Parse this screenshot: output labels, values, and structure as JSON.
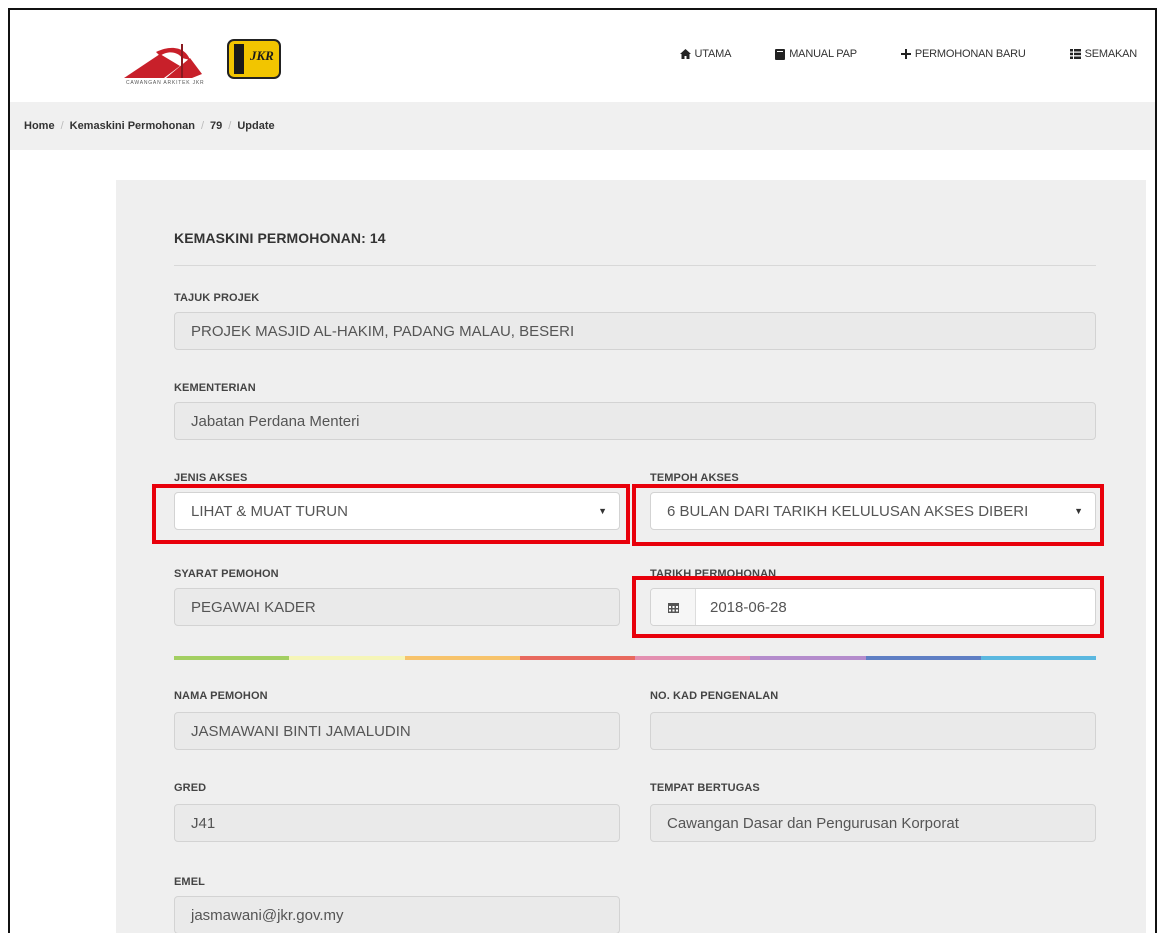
{
  "nav": {
    "utama": "UTAMA",
    "manual": "MANUAL PAP",
    "permohonan_baru": "PERMOHONAN BARU",
    "semakan": "SEMAKAN"
  },
  "logo": {
    "caption": "CAWANGAN ARKITEK JKR",
    "badge": "JKR"
  },
  "breadcrumb": [
    "Home",
    "Kemaskini Permohonan",
    "79",
    "Update"
  ],
  "form": {
    "title": "KEMASKINI PERMOHONAN: 14",
    "tajuk_label": "TAJUK PROJEK",
    "tajuk_value": "PROJEK MASJID AL-HAKIM, PADANG MALAU, BESERI",
    "kementerian_label": "KEMENTERIAN",
    "kementerian_value": "Jabatan Perdana Menteri",
    "jenis_label": "JENIS AKSES",
    "jenis_value": "LIHAT & MUAT TURUN",
    "tempoh_label": "TEMPOH AKSES",
    "tempoh_value": "6 BULAN DARI TARIKH KELULUSAN AKSES DIBERI",
    "syarat_label": "SYARAT PEMOHON",
    "syarat_value": "PEGAWAI KADER",
    "tarikh_label": "TARIKH PERMOHONAN",
    "tarikh_value": "2018-06-28",
    "nama_label": "NAMA PEMOHON",
    "nama_value": "JASMAWANI BINTI JAMALUDIN",
    "ic_label": "NO. KAD PENGENALAN",
    "ic_value": "",
    "gred_label": "GRED",
    "gred_value": "J41",
    "tempat_label": "TEMPAT BERTUGAS",
    "tempat_value": "Cawangan Dasar dan Pengurusan Korporat",
    "emel_label": "EMEL",
    "emel_value": "jasmawani@jkr.gov.my"
  },
  "colors": {
    "highlight": "#e8000b",
    "rainbow": [
      "#a3cf62",
      "#f5f5b8",
      "#f7c36b",
      "#e8695e",
      "#e38fb0",
      "#b48ccc",
      "#5f7fc4",
      "#5bb8e0"
    ]
  }
}
